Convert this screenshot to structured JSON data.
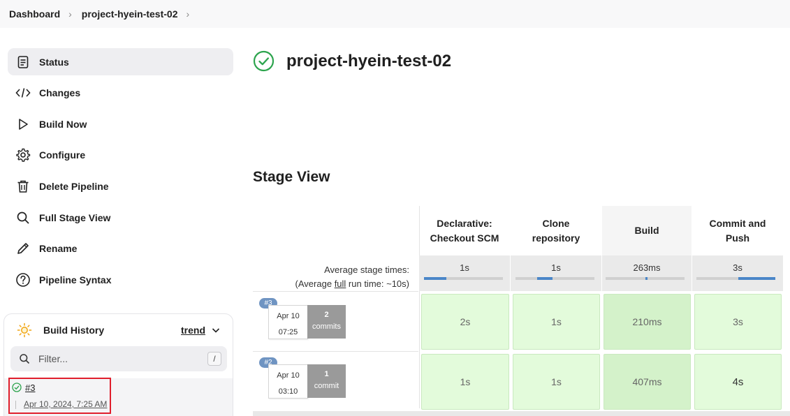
{
  "breadcrumb": {
    "items": [
      "Dashboard",
      "project-hyein-test-02"
    ]
  },
  "sidebar": {
    "items": [
      {
        "label": "Status",
        "icon": "document-icon"
      },
      {
        "label": "Changes",
        "icon": "code-icon"
      },
      {
        "label": "Build Now",
        "icon": "play-icon"
      },
      {
        "label": "Configure",
        "icon": "gear-icon"
      },
      {
        "label": "Delete Pipeline",
        "icon": "trash-icon"
      },
      {
        "label": "Full Stage View",
        "icon": "search-icon"
      },
      {
        "label": "Rename",
        "icon": "pencil-icon"
      },
      {
        "label": "Pipeline Syntax",
        "icon": "help-icon"
      }
    ]
  },
  "build_history": {
    "title": "Build History",
    "trend_label": "trend",
    "filter_placeholder": "Filter...",
    "filter_shortcut": "/",
    "entries": [
      {
        "number": "#3",
        "date": "Apr 10, 2024, 7:25 AM",
        "status": "success"
      }
    ]
  },
  "main": {
    "title": "project-hyein-test-02",
    "status": "success",
    "stage_view_heading": "Stage View"
  },
  "stage_view": {
    "average_label": "Average stage times:",
    "full_run_prefix": "(Average ",
    "full_run_link": "full",
    "full_run_suffix": " run time: ~10s)",
    "stages": [
      {
        "name": "Declarative: Checkout SCM",
        "line1": "Declarative:",
        "line2": "Checkout SCM",
        "avg": "1s",
        "avg_fraction": 0.28
      },
      {
        "name": "Clone repository",
        "line1": "Clone",
        "line2": "repository",
        "avg": "1s",
        "avg_fraction": 0.2
      },
      {
        "name": "Build",
        "line1": "Build",
        "line2": "",
        "avg": "263ms",
        "avg_fraction": 0.03
      },
      {
        "name": "Commit and Push",
        "line1": "Commit and",
        "line2": "Push",
        "avg": "3s",
        "avg_fraction": 0.47
      }
    ],
    "runs": [
      {
        "badge": "#3",
        "date": "Apr 10",
        "time": "07:25",
        "commits_count": "2",
        "commits_label": "commits",
        "durations": [
          "2s",
          "1s",
          "210ms",
          "3s"
        ]
      },
      {
        "badge": "#2",
        "date": "Apr 10",
        "time": "03:10",
        "commits_count": "1",
        "commits_label": "commit",
        "durations": [
          "1s",
          "1s",
          "407ms",
          "4s"
        ]
      }
    ]
  },
  "colors": {
    "success_green": "#2da44e",
    "cell_green": "#e3fbdb",
    "badge_blue": "#6f94c2",
    "highlight_red": "#e01e2c"
  }
}
